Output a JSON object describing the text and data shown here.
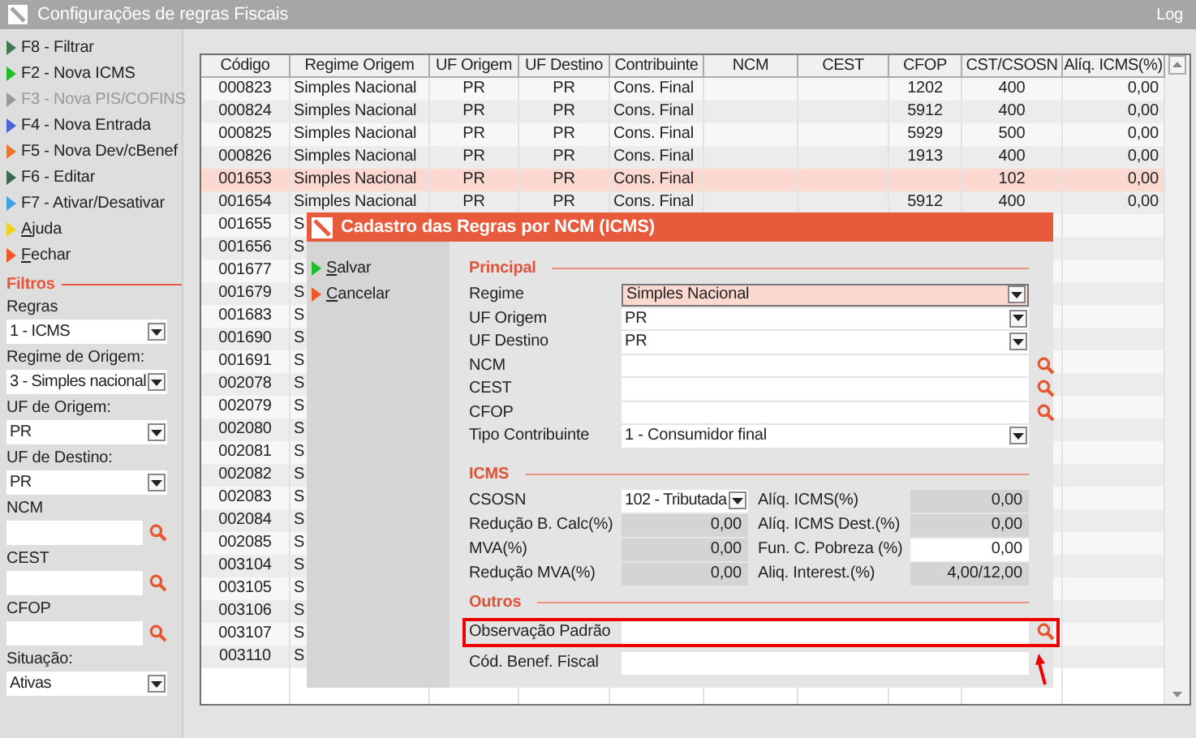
{
  "window": {
    "title": "Configurações de regras Fiscais",
    "log": "Log"
  },
  "menu": [
    {
      "label": "F8 - Filtrar",
      "color": "#3f7a55",
      "disabled": false,
      "accelerator": false
    },
    {
      "label": "F2 - Nova ICMS",
      "color": "#1fbf2a",
      "disabled": false,
      "accelerator": false
    },
    {
      "label": "F3 - Nova PIS/COFINS",
      "color": "#9a9a9a",
      "disabled": true,
      "accelerator": false
    },
    {
      "label": "F4 - Nova Entrada",
      "color": "#4a63d6",
      "disabled": false,
      "accelerator": false
    },
    {
      "label": "F5 - Nova Dev/cBenef",
      "color": "#e8792c",
      "disabled": false,
      "accelerator": false
    },
    {
      "label": "F6 - Editar",
      "color": "#3a6a4c",
      "disabled": false,
      "accelerator": false
    },
    {
      "label": "F7 - Ativar/Desativar",
      "color": "#3aa3e3",
      "disabled": false,
      "accelerator": false
    },
    {
      "label": "Ajuda",
      "color": "#f2d21c",
      "disabled": false,
      "accelerator": true
    },
    {
      "label": "Fechar",
      "color": "#f0582a",
      "disabled": false,
      "accelerator": true
    }
  ],
  "filters": {
    "title": "Filtros",
    "items": [
      {
        "kind": "select",
        "label": "Regras",
        "value": "1 - ICMS"
      },
      {
        "kind": "select",
        "label": "Regime de Origem:",
        "value": "3 - Simples nacional"
      },
      {
        "kind": "select",
        "label": "UF de Origem:",
        "value": "PR"
      },
      {
        "kind": "select",
        "label": "UF de Destino:",
        "value": "PR"
      },
      {
        "kind": "search",
        "label": "NCM"
      },
      {
        "kind": "search",
        "label": "CEST"
      },
      {
        "kind": "search",
        "label": "CFOP"
      },
      {
        "kind": "select",
        "label": "Situação:",
        "value": "Ativas"
      }
    ]
  },
  "table": {
    "columns": [
      "Código",
      "Regime Origem",
      "UF Origem",
      "UF Destino",
      "Contribuinte",
      "NCM",
      "CEST",
      "CFOP",
      "CST/CSOSN",
      "Alíq. ICMS(%)"
    ],
    "rows": [
      {
        "cells": [
          "000823",
          "Simples Nacional",
          "PR",
          "PR",
          "Cons. Final",
          "",
          "",
          "1202",
          "400",
          "0,00"
        ],
        "selected": false
      },
      {
        "cells": [
          "000824",
          "Simples Nacional",
          "PR",
          "PR",
          "Cons. Final",
          "",
          "",
          "5912",
          "400",
          "0,00"
        ],
        "selected": false
      },
      {
        "cells": [
          "000825",
          "Simples Nacional",
          "PR",
          "PR",
          "Cons. Final",
          "",
          "",
          "5929",
          "500",
          "0,00"
        ],
        "selected": false
      },
      {
        "cells": [
          "000826",
          "Simples Nacional",
          "PR",
          "PR",
          "Cons. Final",
          "",
          "",
          "1913",
          "400",
          "0,00"
        ],
        "selected": false
      },
      {
        "cells": [
          "001653",
          "Simples Nacional",
          "PR",
          "PR",
          "Cons. Final",
          "",
          "",
          "",
          "102",
          "0,00"
        ],
        "selected": true
      },
      {
        "cells": [
          "001654",
          "Simples Nacional",
          "PR",
          "PR",
          "Cons. Final",
          "",
          "",
          "5912",
          "400",
          "0,00"
        ],
        "selected": false
      },
      {
        "cells": [
          "001655",
          "S"
        ],
        "selected": false
      },
      {
        "cells": [
          "001656",
          "S"
        ],
        "selected": false
      },
      {
        "cells": [
          "001677",
          "S"
        ],
        "selected": false
      },
      {
        "cells": [
          "001679",
          "S"
        ],
        "selected": false
      },
      {
        "cells": [
          "001683",
          "S"
        ],
        "selected": false
      },
      {
        "cells": [
          "001690",
          "S"
        ],
        "selected": false
      },
      {
        "cells": [
          "001691",
          "S"
        ],
        "selected": false
      },
      {
        "cells": [
          "002078",
          "S"
        ],
        "selected": false
      },
      {
        "cells": [
          "002079",
          "S"
        ],
        "selected": false
      },
      {
        "cells": [
          "002080",
          "S"
        ],
        "selected": false
      },
      {
        "cells": [
          "002081",
          "S"
        ],
        "selected": false
      },
      {
        "cells": [
          "002082",
          "S"
        ],
        "selected": false
      },
      {
        "cells": [
          "002083",
          "S"
        ],
        "selected": false
      },
      {
        "cells": [
          "002084",
          "S"
        ],
        "selected": false
      },
      {
        "cells": [
          "002085",
          "S"
        ],
        "selected": false
      },
      {
        "cells": [
          "003104",
          "S"
        ],
        "selected": false
      },
      {
        "cells": [
          "003105",
          "S"
        ],
        "selected": false
      },
      {
        "cells": [
          "003106",
          "S"
        ],
        "selected": false
      },
      {
        "cells": [
          "003107",
          "S"
        ],
        "selected": false
      },
      {
        "cells": [
          "003110",
          "S"
        ],
        "selected": false
      }
    ]
  },
  "dialog": {
    "title": "Cadastro das Regras por NCM (ICMS)",
    "actions": [
      {
        "label": "Salvar",
        "color": "#1fbf2a"
      },
      {
        "label": "Cancelar",
        "color": "#f0582a"
      }
    ],
    "principal": {
      "title": "Principal",
      "fields": [
        {
          "kind": "select",
          "label": "Regime",
          "value": "Simples Nacional",
          "focused": true
        },
        {
          "kind": "select",
          "label": "UF Origem",
          "value": "PR",
          "focused": false
        },
        {
          "kind": "select",
          "label": "UF Destino",
          "value": "PR",
          "focused": false
        },
        {
          "kind": "search",
          "label": "NCM"
        },
        {
          "kind": "search",
          "label": "CEST"
        },
        {
          "kind": "search",
          "label": "CFOP"
        },
        {
          "kind": "select",
          "label": "Tipo Contribuinte",
          "value": "1 - Consumidor final",
          "focused": false
        }
      ]
    },
    "icms": {
      "title": "ICMS",
      "fields": [
        {
          "kind": "select",
          "label": "CSOSN",
          "value": "102 - Tributada"
        },
        {
          "kind": "number",
          "label": "Alíq. ICMS(%)",
          "value": "0,00",
          "disabled": true
        },
        {
          "kind": "number",
          "label": "Redução B. Calc(%)",
          "value": "0,00",
          "disabled": true
        },
        {
          "kind": "number",
          "label": "Alíq. ICMS Dest.(%)",
          "value": "0,00",
          "disabled": true
        },
        {
          "kind": "number",
          "label": "MVA(%)",
          "value": "0,00",
          "disabled": true
        },
        {
          "kind": "number",
          "label": "Fun. C. Pobreza (%)",
          "value": "0,00",
          "disabled": false
        },
        {
          "kind": "number",
          "label": "Redução MVA(%)",
          "value": "0,00",
          "disabled": true
        },
        {
          "kind": "number",
          "label": "Aliq. Interest.(%)",
          "value": "4,00/12,00",
          "disabled": true
        }
      ]
    },
    "outros": {
      "title": "Outros",
      "fields": [
        {
          "kind": "search",
          "label": "Observação Padrão",
          "highlighted": true
        },
        {
          "kind": "text",
          "label": "Cód. Benef. Fiscal",
          "highlighted": false
        }
      ]
    }
  }
}
